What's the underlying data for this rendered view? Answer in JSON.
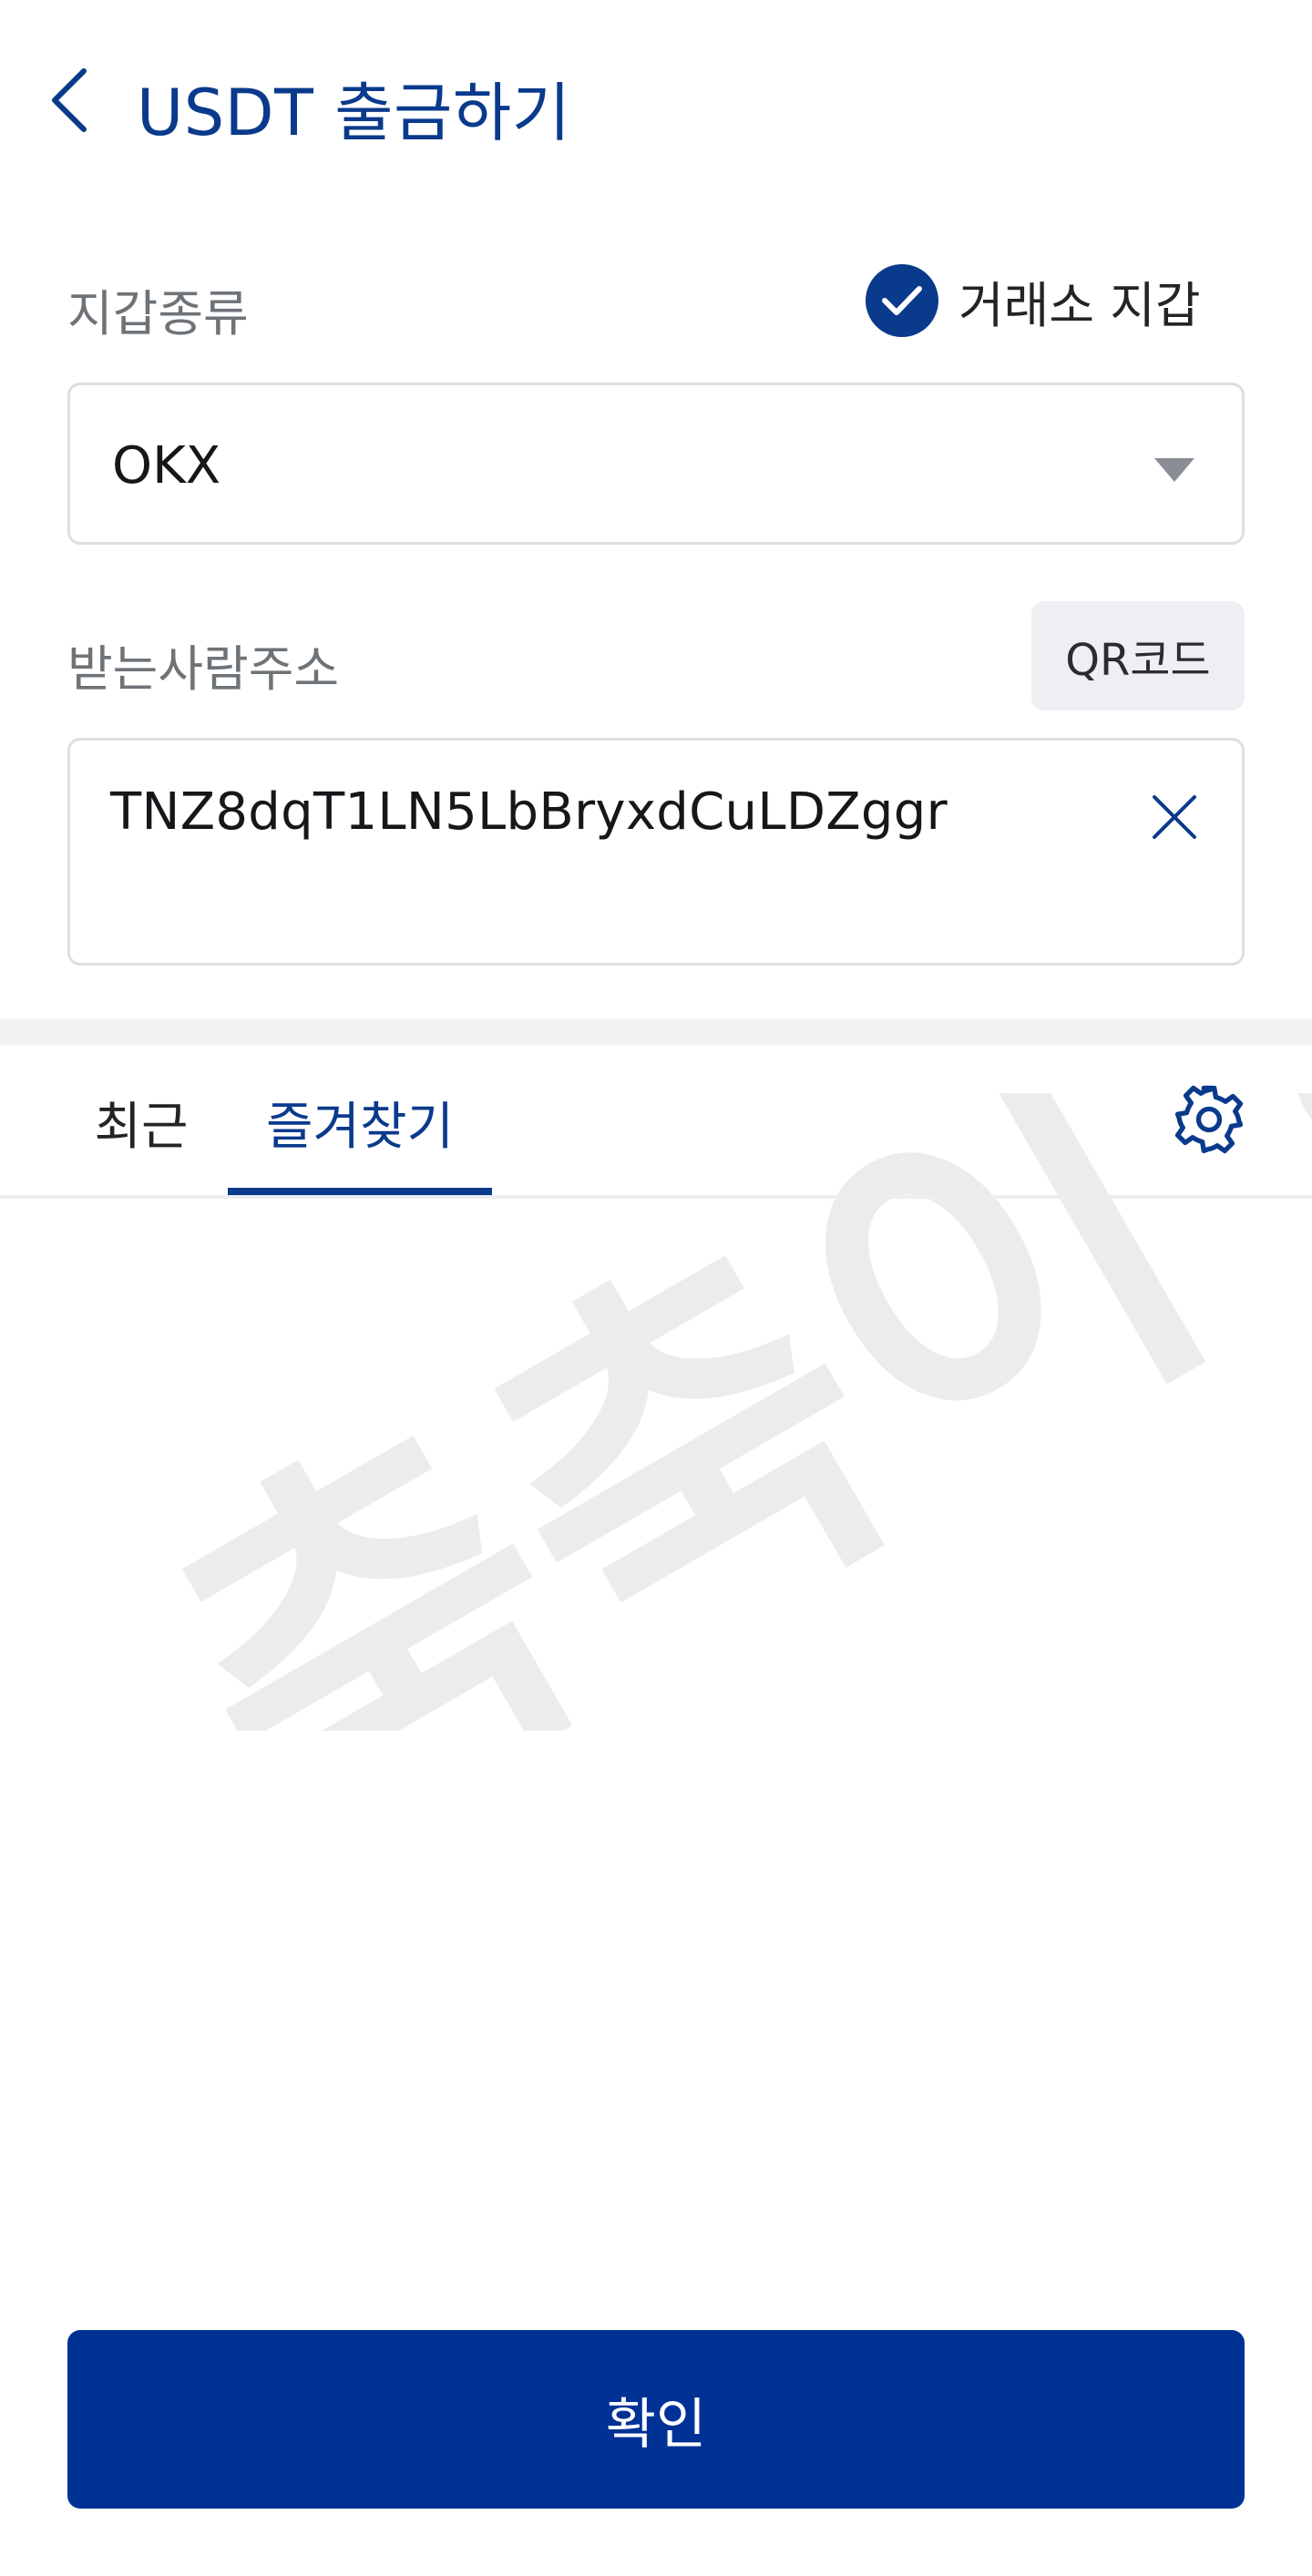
{
  "header": {
    "title": "USDT 출금하기",
    "back_icon": "chevron-left-icon"
  },
  "wallet": {
    "label": "지갑종류",
    "exchange_toggle_label": "거래소 지갑",
    "exchange_toggle_checked": true,
    "selected": "OKX"
  },
  "recipient": {
    "label": "받는사람주소",
    "qr_button": "QR코드",
    "address": "TNZ8dqT1LN5LbBryxdCuLDZggr"
  },
  "tabs": {
    "items": [
      {
        "label": "최근",
        "active": false
      },
      {
        "label": "즐겨찾기",
        "active": true
      }
    ],
    "settings_icon": "gear-icon"
  },
  "watermark": {
    "text": "축축이 하우스"
  },
  "confirm": {
    "label": "확인"
  },
  "colors": {
    "brand": "#0a3a8c",
    "button": "#003296",
    "border": "#dcdee2",
    "muted_text": "#6e7378"
  }
}
